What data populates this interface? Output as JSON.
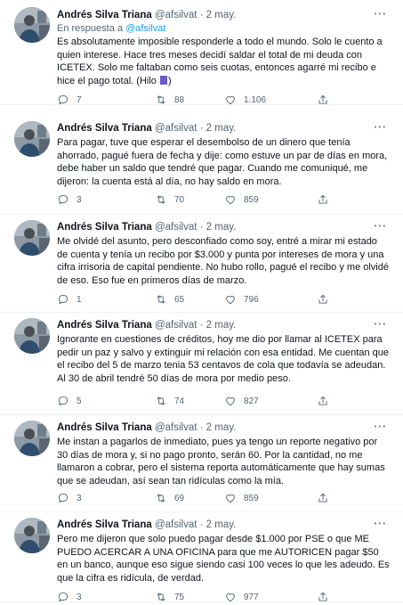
{
  "tweets": [
    {
      "name": "Andrés Silva Triana",
      "handle": "@afsilvat",
      "dot": "·",
      "date": "2 may.",
      "reply_prefix": "En respuesta a",
      "reply_handle": "@afsilvat",
      "text": "Es absolutamente imposible responderle a todo el mundo. Solo le cuento a quien interese.  Hace tres meses decidí saldar el total de mi deuda con ICETEX. Solo me faltaban como seis cuotas, entonces agarré mi recibo e hice el pago total. (Hilo ",
      "text_end": ")",
      "replies": "7",
      "retweets": "88",
      "likes": "1.106"
    },
    {
      "name": "Andrés Silva Triana",
      "handle": "@afsilvat",
      "dot": "·",
      "date": "2 may.",
      "text": "Para pagar, tuve que esperar el desembolso de un dinero que tenía ahorrado, pagué fuera de fecha y dije: como estuve un par de días en mora, debe haber un saldo que tendré que pagar. Cuando me comuniqué, me dijeron: la cuenta está al día, no hay saldo en mora.",
      "replies": "3",
      "retweets": "70",
      "likes": "859"
    },
    {
      "name": "Andrés Silva Triana",
      "handle": "@afsilvat",
      "dot": "·",
      "date": "2 may.",
      "text": "Me olvidé del asunto, pero desconfiado como soy, entré a mirar mi estado de cuenta y tenía un recibo por $3.000 y punta por intereses de mora y una cifra irrisoria de capital pendiente. No hubo rollo, pagué el recibo y me olvidé de eso. Eso fue en primeros días de marzo.",
      "replies": "1",
      "retweets": "65",
      "likes": "796"
    },
    {
      "name": "Andrés Silva Triana",
      "handle": "@afsilvat",
      "dot": "·",
      "date": "2 may.",
      "text": "Ignorante en cuestiones de créditos, hoy me dio por llamar al ICETEX para pedir un paz y salvo y extinguir mi relación con esa entidad. Me cuentan que el recibo del 5 de marzo tenia 53 centavos de cola que todavía se adeudan. Al 30 de abril tendré 50 días de mora por medio peso.",
      "replies": "5",
      "retweets": "74",
      "likes": "827"
    },
    {
      "name": "Andrés Silva Triana",
      "handle": "@afsilvat",
      "dot": "·",
      "date": "2 may.",
      "text": "Me instan a pagarlos de inmediato, pues ya tengo un reporte negativo por 30 días de mora y, si no pago pronto, serán 60. Por la cantidad, no me llamaron a cobrar, pero el sistema reporta automáticamente que hay sumas que se adeudan, así sean tan ridículas como la mía.",
      "replies": "3",
      "retweets": "69",
      "likes": "859"
    },
    {
      "name": "Andrés Silva Triana",
      "handle": "@afsilvat",
      "dot": "·",
      "date": "2 may.",
      "text": "Pero me dijeron que solo puedo pagar desde $1.000 por PSE o que ME PUEDO ACERCAR A UNA OFICINA para que me AUTORICEN pagar $50 en un banco, aunque eso sigue siendo casi 100 veces lo que les adeudo. Es que la cifra es ridícula, de verdad.",
      "replies": "3",
      "retweets": "75",
      "likes": "977"
    }
  ],
  "icons": {
    "more": "more-horizontal-icon",
    "reply": "reply-icon",
    "retweet": "retweet-icon",
    "like": "heart-icon",
    "share": "share-icon",
    "thread_emoji": "purple-block-emoji"
  },
  "colors": {
    "link": "#1d9bf0",
    "secondary_text": "#536471",
    "primary_text": "#0f1419",
    "divider": "#eff3f4"
  }
}
